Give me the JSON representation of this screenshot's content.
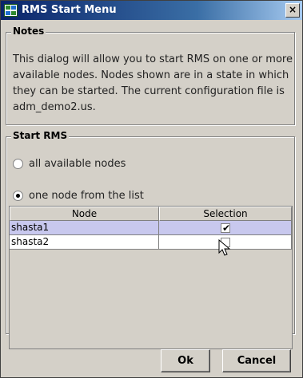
{
  "window": {
    "title": "RMS Start Menu",
    "close_label": "×"
  },
  "notes": {
    "title": "Notes",
    "text": "This dialog will allow you to start RMS on one or more available nodes. Nodes shown are in a state in which they can be started. The current configuration file is adm_demo2.us."
  },
  "start_rms": {
    "title": "Start RMS",
    "options": [
      {
        "label": "all available nodes",
        "selected": false
      },
      {
        "label": "one node from the list",
        "selected": true
      }
    ]
  },
  "table": {
    "columns": [
      "Node",
      "Selection"
    ],
    "rows": [
      {
        "node": "shasta1",
        "checked": true,
        "highlighted": true
      },
      {
        "node": "shasta2",
        "checked": false,
        "highlighted": false
      }
    ]
  },
  "buttons": {
    "ok": "Ok",
    "cancel": "Cancel"
  },
  "icons": {
    "app": "rms-app-icon",
    "cursor": "mouse-pointer-icon"
  }
}
